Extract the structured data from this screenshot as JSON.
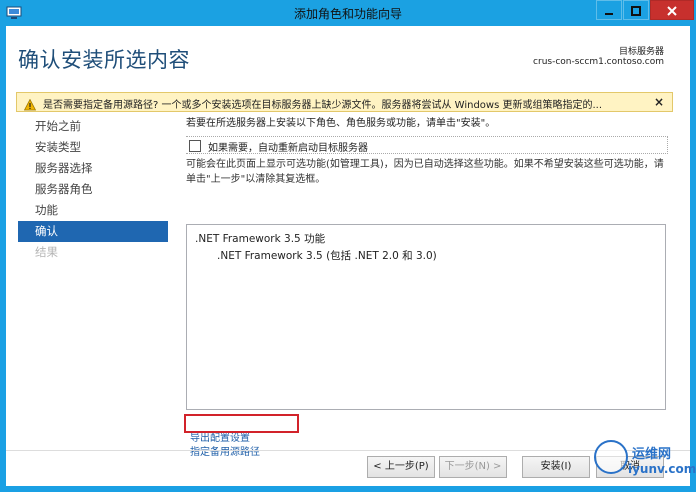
{
  "window": {
    "title": "添加角色和功能向导"
  },
  "header": {
    "title": "确认安装所选内容",
    "destination_label": "目标服务器",
    "destination_server": "crus-con-sccm1.contoso.com"
  },
  "warning": {
    "text": "是否需要指定备用源路径? 一个或多个安装选项在目标服务器上缺少源文件。服务器将尝试从 Windows 更新或组策略指定的...",
    "close": "×"
  },
  "nav": {
    "items": [
      {
        "label": "开始之前",
        "state": "normal"
      },
      {
        "label": "安装类型",
        "state": "normal"
      },
      {
        "label": "服务器选择",
        "state": "normal"
      },
      {
        "label": "服务器角色",
        "state": "normal"
      },
      {
        "label": "功能",
        "state": "normal"
      },
      {
        "label": "确认",
        "state": "active"
      },
      {
        "label": "结果",
        "state": "disabled"
      }
    ]
  },
  "main": {
    "intro": "若要在所选服务器上安装以下角色、角色服务或功能，请单击\"安装\"。",
    "restart_label": "如果需要，自动重新启动目标服务器",
    "restart_checked": false,
    "note": "可能会在此页面上显示可选功能(如管理工具)，因为已自动选择这些功能。如果不希望安装这些可选功能，请单击\"上一步\"以清除其复选框。",
    "features": [
      ".NET Framework 3.5 功能",
      ".NET Framework 3.5 (包括 .NET 2.0 和 3.0)"
    ],
    "export_link": "导出配置设置",
    "alt_source_link": "指定备用源路径"
  },
  "footer": {
    "prev": "< 上一步(P)",
    "next": "下一步(N) >",
    "install": "安装(I)",
    "cancel": "取消"
  },
  "watermark": {
    "line1": "运维网",
    "line2": "iyunv.com"
  },
  "colors": {
    "titlebar": "#1ba1e2",
    "nav_active": "#1f67b1",
    "title_text": "#1f4e79",
    "warning_bg": "#fff3c3",
    "highlight": "#d2232a"
  }
}
